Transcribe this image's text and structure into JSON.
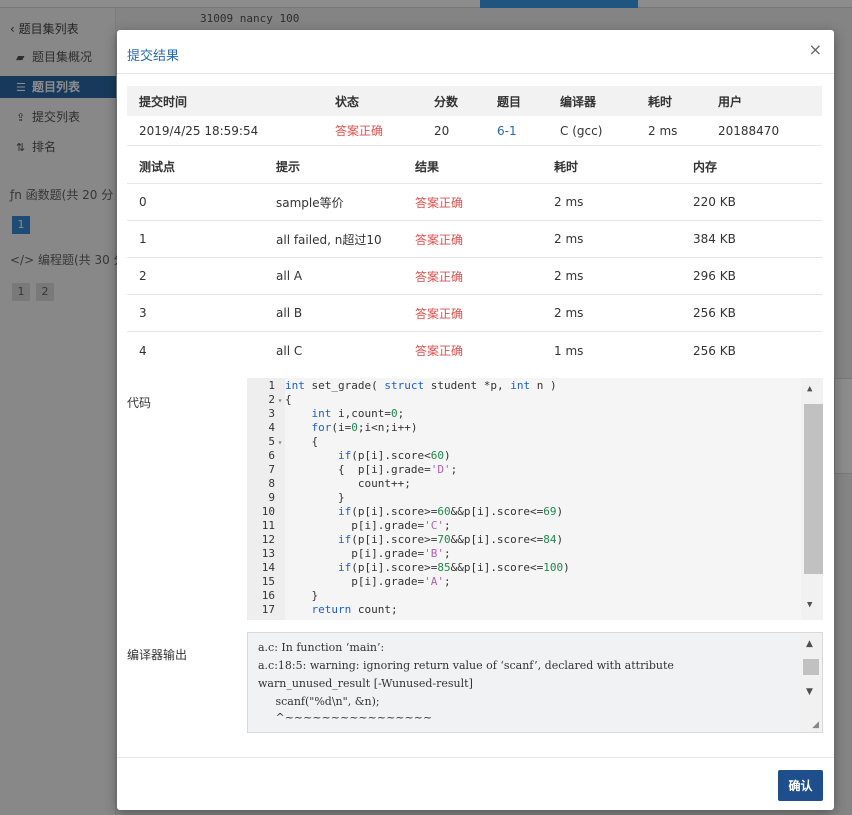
{
  "background": {
    "back_label": "题目集列表",
    "menu": [
      {
        "icon": "book-icon",
        "glyph": "▰",
        "label": "题目集概况"
      },
      {
        "icon": "list-icon",
        "glyph": "☰",
        "label": "题目列表"
      },
      {
        "icon": "upload-icon",
        "glyph": "⇪",
        "label": "提交列表"
      },
      {
        "icon": "sort-icon",
        "glyph": "⇅",
        "label": "排名"
      }
    ],
    "groups": [
      {
        "icon": "function-icon",
        "glyph": "ƒn",
        "label": "函数题(共 20 分"
      },
      {
        "icon": "code-icon",
        "glyph": "</>",
        "label": "编程题(共 30 分"
      }
    ],
    "func_pages": [
      "1"
    ],
    "prog_pages": [
      "1",
      "2"
    ],
    "code_line": "31009 nancy 100"
  },
  "modal": {
    "title": "提交结果",
    "close_glyph": "×",
    "summary_headers": [
      "提交时间",
      "状态",
      "分数",
      "题目",
      "编译器",
      "耗时",
      "用户"
    ],
    "summary_row": {
      "time": "2019/4/25 18:59:54",
      "status": "答案正确",
      "score": "20",
      "problem": "6-1",
      "compiler": "C (gcc)",
      "cost": "2 ms",
      "user": "20188470"
    },
    "test_headers": [
      "测试点",
      "提示",
      "结果",
      "耗时",
      "内存"
    ],
    "tests": [
      {
        "point": "0",
        "hint": "sample等价",
        "result": "答案正确",
        "time": "2 ms",
        "memory": "220 KB"
      },
      {
        "point": "1",
        "hint": "all failed, n超过10",
        "result": "答案正确",
        "time": "2 ms",
        "memory": "384 KB"
      },
      {
        "point": "2",
        "hint": "all A",
        "result": "答案正确",
        "time": "2 ms",
        "memory": "296 KB"
      },
      {
        "point": "3",
        "hint": "all B",
        "result": "答案正确",
        "time": "2 ms",
        "memory": "256 KB"
      },
      {
        "point": "4",
        "hint": "all C",
        "result": "答案正确",
        "time": "1 ms",
        "memory": "256 KB"
      }
    ],
    "code_label": "代码",
    "code_lines": [
      "int set_grade( struct student *p, int n )",
      "{",
      "    int i,count=0;",
      "    for(i=0;i<n;i++)",
      "    {",
      "        if(p[i].score<60)",
      "        {  p[i].grade='D';",
      "           count++;",
      "        }",
      "        if(p[i].score>=60&&p[i].score<=69)",
      "          p[i].grade='C';",
      "        if(p[i].score>=70&&p[i].score<=84)",
      "          p[i].grade='B';",
      "        if(p[i].score>=85&&p[i].score<=100)",
      "          p[i].grade='A';",
      "    }",
      "    return count;"
    ],
    "compiler_label": "编译器输出",
    "compiler_output": [
      "a.c: In function ‘main’:",
      "a.c:18:5: warning: ignoring return value of ‘scanf’, declared with attribute",
      "warn_unused_result [-Wunused-result]",
      "     scanf(\"%d\\n\", &n);",
      "     ^~~~~~~~~~~~~~~~~"
    ],
    "ok_label": "确认"
  },
  "colors": {
    "accent": "#2a6aa8",
    "status_ok": "#d9534f",
    "button": "#1f4e8c"
  }
}
